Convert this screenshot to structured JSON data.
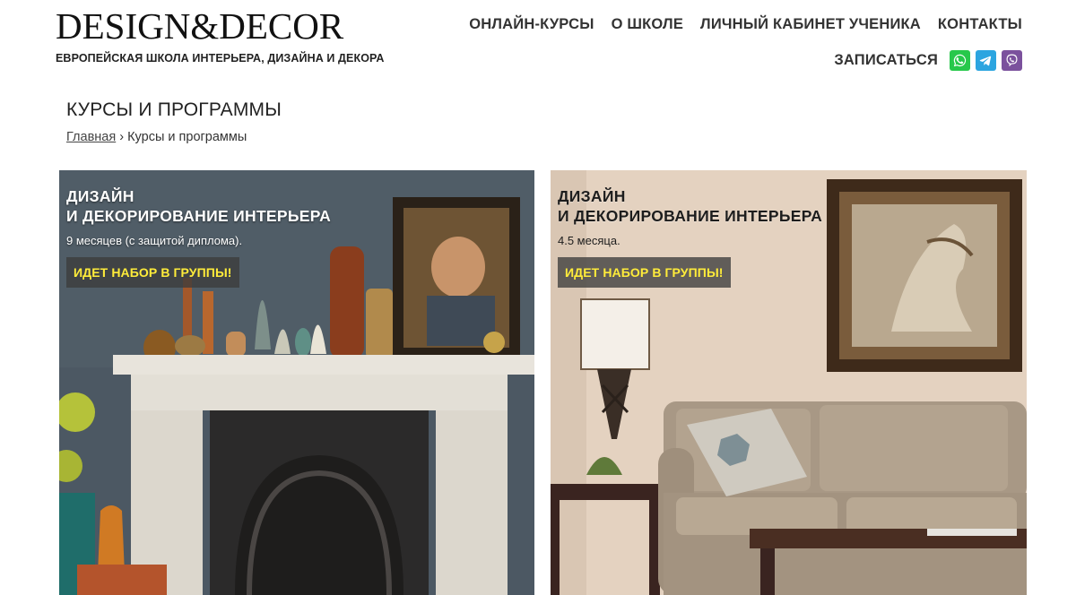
{
  "header": {
    "logo_title": "DESIGN&DECOR",
    "logo_subtitle": "ЕВРОПЕЙСКАЯ ШКОЛА ИНТЕРЬЕРА, ДИЗАЙНА И ДЕКОРА",
    "nav": [
      {
        "label": "ОНЛАЙН-КУРСЫ"
      },
      {
        "label": "О ШКОЛЕ"
      },
      {
        "label": "ЛИЧНЫЙ КАБИНЕТ УЧЕНИКА"
      },
      {
        "label": "КОНТАКТЫ"
      }
    ],
    "signup_label": "ЗАПИСАТЬСЯ",
    "messengers": [
      {
        "icon": "whatsapp-icon",
        "color": "#27c84b"
      },
      {
        "icon": "telegram-icon",
        "color": "#2ca5e0"
      },
      {
        "icon": "viber-icon",
        "color": "#7b519d"
      }
    ]
  },
  "page": {
    "title": "КУРСЫ И ПРОГРАММЫ",
    "breadcrumb": {
      "home": "Главная",
      "separator": "›",
      "current": "Курсы и программы"
    }
  },
  "cards": [
    {
      "title_line1": "ДИЗАЙН",
      "title_line2": "И ДЕКОРИРОВАНИЕ ИНТЕРЬЕРА",
      "duration": "9 месяцев (с защитой диплома).",
      "badge": "ИДЕТ НАБОР В ГРУППЫ!"
    },
    {
      "title_line1": "ДИЗАЙН",
      "title_line2": "И ДЕКОРИРОВАНИЕ ИНТЕРЬЕРА",
      "duration": "4.5 месяца.",
      "badge": "ИДЕТ НАБОР В ГРУППЫ!"
    }
  ],
  "colors": {
    "badge_text": "#ffec3a",
    "badge_bg": "#3c3c3c"
  }
}
